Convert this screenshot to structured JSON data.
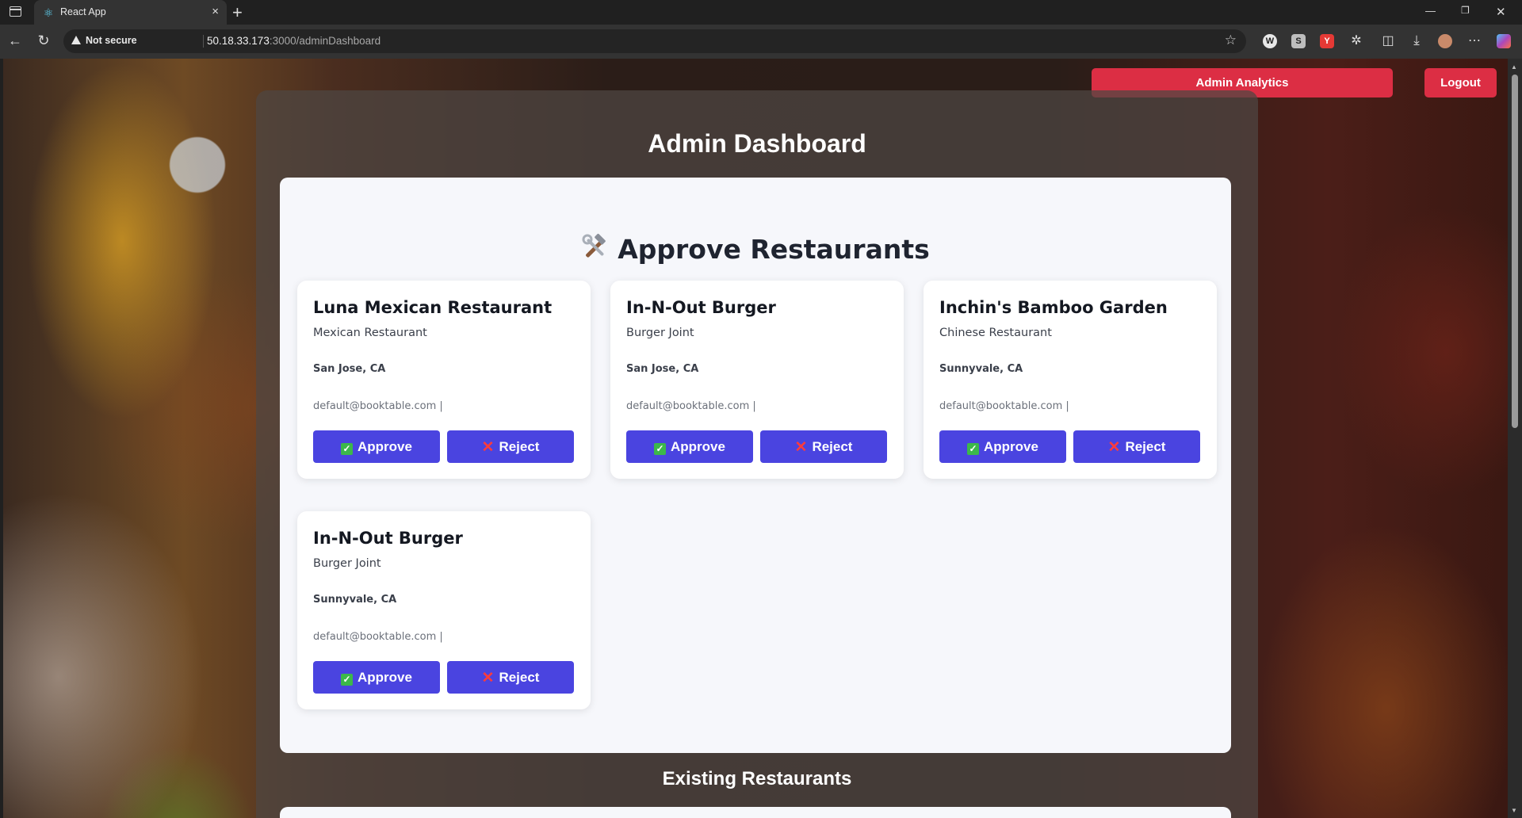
{
  "browser": {
    "tab_title": "React App",
    "new_tab_label": "+",
    "close_tab_label": "×",
    "security_label": "Not secure",
    "url_host": "50.18.33.173",
    "url_path": ":3000/adminDashboard"
  },
  "header": {
    "analytics_label": "Admin Analytics",
    "logout_label": "Logout",
    "page_title": "Admin Dashboard"
  },
  "approve_section": {
    "title": "Approve Restaurants",
    "icon": "hammer-and-wrench-icon",
    "approve_label": "Approve",
    "reject_label": "Reject",
    "restaurants": [
      {
        "name": "Luna Mexican Restaurant",
        "type": "Mexican Restaurant",
        "location": "San Jose, CA",
        "contact": "default@booktable.com |"
      },
      {
        "name": "In-N-Out Burger",
        "type": "Burger Joint",
        "location": "San Jose, CA",
        "contact": "default@booktable.com |"
      },
      {
        "name": "Inchin's Bamboo Garden",
        "type": "Chinese Restaurant",
        "location": "Sunnyvale, CA",
        "contact": "default@booktable.com |"
      },
      {
        "name": "In-N-Out Burger",
        "type": "Burger Joint",
        "location": "Sunnyvale, CA",
        "contact": "default@booktable.com |"
      }
    ]
  },
  "existing_section": {
    "title": "Existing Restaurants"
  },
  "colors": {
    "accent_red": "#dc2e44",
    "button_indigo": "#4a44e0"
  }
}
